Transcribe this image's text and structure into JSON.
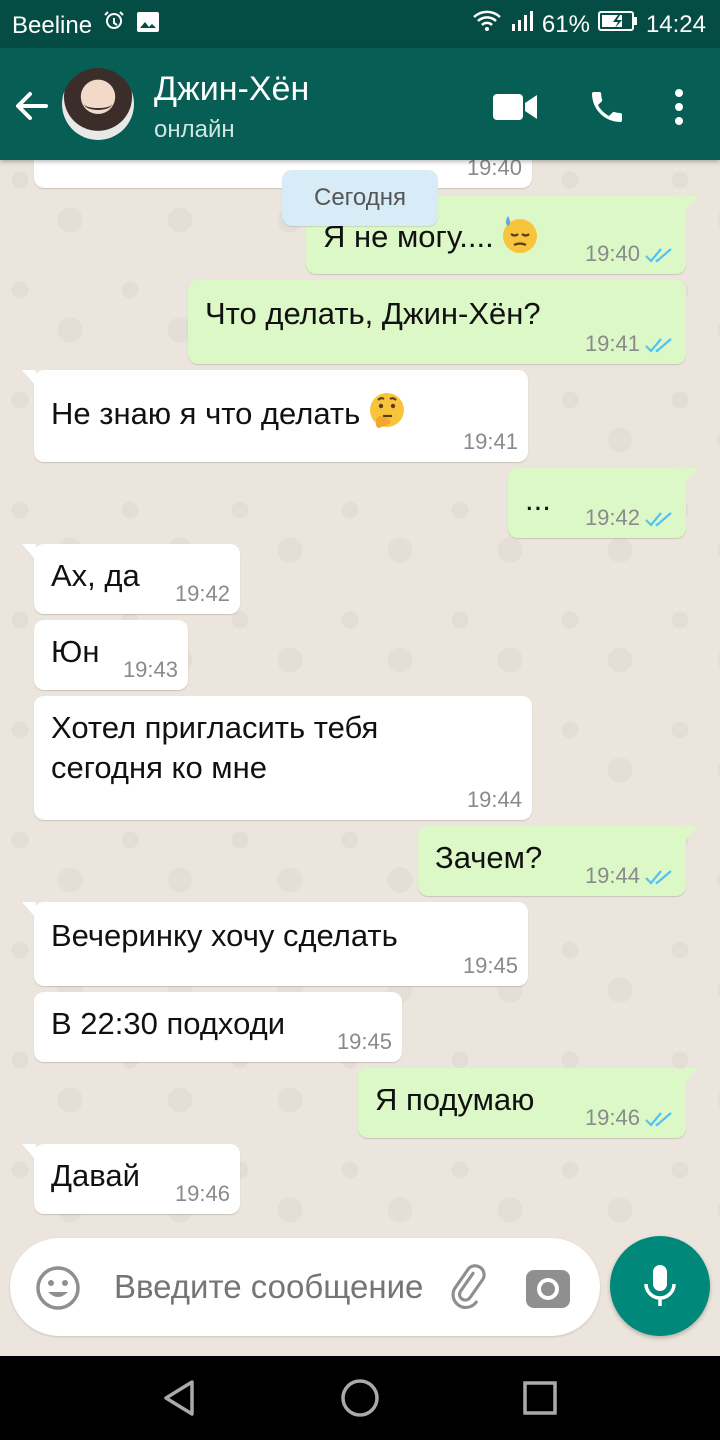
{
  "status_bar": {
    "carrier": "Beeline",
    "battery": "61%",
    "time": "14:24"
  },
  "header": {
    "contact_name": "Джин-Хён",
    "contact_status": "онлайн",
    "icons": [
      "back-arrow-icon",
      "video-call-icon",
      "phone-call-icon",
      "more-vert-icon"
    ],
    "accent_color": "#075e54"
  },
  "chat": {
    "date_chip": "Сегодня",
    "partial_top_time": "19:40",
    "messages": [
      {
        "dir": "out",
        "text": "Я не могу....",
        "emoji": "downcast-sweat-emoji",
        "time": "19:40",
        "read": true
      },
      {
        "dir": "out",
        "text": "Что делать, Джин-Хён?",
        "time": "19:41",
        "read": true
      },
      {
        "dir": "in",
        "text": "Не знаю я что делать",
        "emoji": "thinking-face-emoji",
        "time": "19:41"
      },
      {
        "dir": "out",
        "text": "...",
        "time": "19:42",
        "read": true
      },
      {
        "dir": "in",
        "text": "Ах, да",
        "time": "19:42"
      },
      {
        "dir": "in",
        "text": "Юн",
        "time": "19:43"
      },
      {
        "dir": "in",
        "text_line1": "Хотел пригласить тебя",
        "text_line2": "сегодня ко мне",
        "time": "19:44"
      },
      {
        "dir": "out",
        "text": "Зачем?",
        "time": "19:44",
        "read": true
      },
      {
        "dir": "in",
        "text": "Вечеринку хочу сделать",
        "time": "19:45"
      },
      {
        "dir": "in",
        "text": "В 22:30 подходи",
        "time": "19:45"
      },
      {
        "dir": "out",
        "text": "Я подумаю",
        "time": "19:46",
        "read": true
      },
      {
        "dir": "in",
        "text": "Давай",
        "time": "19:46"
      }
    ],
    "outgoing_bubble_color": "#dcf8c6",
    "incoming_bubble_color": "#ffffff",
    "read_tick_color": "#4fc3f7"
  },
  "composer": {
    "placeholder": "Введите сообщение",
    "icons": [
      "emoji-icon",
      "attach-icon",
      "camera-icon",
      "mic-icon"
    ]
  },
  "nav_bar": {
    "icons": [
      "back-triangle-icon",
      "home-circle-icon",
      "recents-square-icon"
    ]
  }
}
